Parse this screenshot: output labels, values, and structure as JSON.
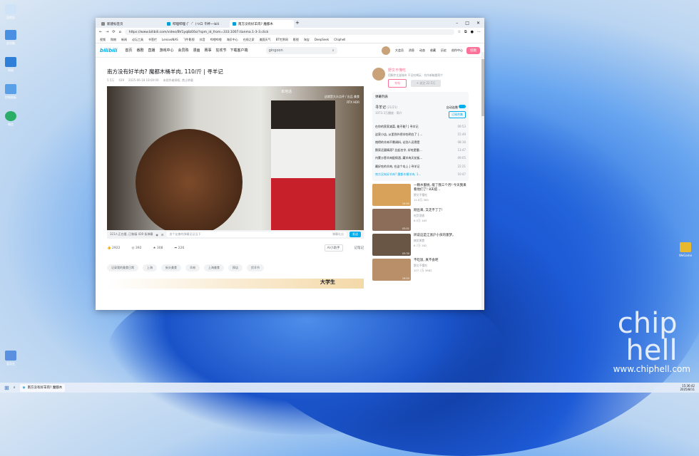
{
  "desktop": {
    "icons": [
      {
        "label": "回收站"
      },
      {
        "label": "此电脑"
      },
      {
        "label": "网络"
      },
      {
        "label": "控制面板"
      },
      {
        "label": "微信"
      }
    ],
    "right_icon": "WeGame",
    "bottom_icon": "爱奇艺"
  },
  "browser": {
    "tabs": [
      {
        "label": "新建标签页"
      },
      {
        "label": "哔哩哔哩 (゜-゜)つロ 干杯~-bili"
      },
      {
        "label": "南方没有好羊肉? 魔都木"
      }
    ],
    "url": "https://www.bilibili.com/video/BV1yq8zE6o/?spm_id_from=333.1007.tianma.1-3-3.click",
    "bookmarks": [
      "视频",
      "购物",
      "新闻",
      "论坛工具",
      "书签栏",
      "LenovoNAS",
      "飞牛影视",
      "抖音",
      "哔哩哔哩",
      "海贝中心",
      "在线之家",
      "美国天气",
      "BT世界网",
      "影视",
      "淘宝",
      "DeepSeek",
      "Chiphell"
    ]
  },
  "nav": {
    "logo": "bilibili",
    "items": [
      "首页",
      "番剧",
      "直播",
      "游戏中心",
      "会员购",
      "漫画",
      "赛事",
      "狂欢节"
    ],
    "download": "下载客户端",
    "search_placeholder": "gingoon",
    "right": [
      "大会员",
      "消息",
      "动态",
      "收藏",
      "历史",
      "创作中心"
    ],
    "upload": "投稿"
  },
  "video": {
    "title": "南方没有好羊肉? 魔都木桶羊肉, 110/斤 | 寻羊记",
    "views": "5.5万",
    "danmaku": "439",
    "date": "2025-06-18 18:00:00",
    "note": "未经作者授权, 禁止转载",
    "overlay_tl": "本地话",
    "overlay_tr": "这就是大众点评 / 出品 美食",
    "overlay_tr2": "RTX HDR",
    "online": "323人正在看, 已装填 439 条弹幕",
    "danmaku_placeholder": "发个友善的弹幕见证当下",
    "danmaku_etiquette": "弹幕礼仪",
    "send": "发送",
    "likes": "2922",
    "coins": "392",
    "favs": "308",
    "shares": "226",
    "ai": "AI小助手",
    "notes": "记笔记",
    "tags": [
      "记录我的美食日常",
      "上海",
      "街头美食",
      "羊肉",
      "上海美食",
      "探店",
      "伏羊节"
    ],
    "ad_text": "大学生"
  },
  "uploader": {
    "name": "野文不懂吃",
    "desc": "用脚步丈量城市 不见吃喝玩 · 合作邮箱看简介",
    "charge": "充电",
    "follow": "+ 关注 22.5万"
  },
  "playlist": {
    "heading": "弹幕列表",
    "name": "寻羊记",
    "count": "(21/21)",
    "views": "1073.3万播放 · 简介",
    "autoplay": "自动连播",
    "subscribe": "订阅合集",
    "items": [
      {
        "t": "在你的家家减菜, 能不能? | 寻羊记",
        "d": "09:53"
      },
      {
        "t": "这家小店, 从里到外把羊吃明白了 | ...",
        "d": "15:49"
      },
      {
        "t": "炮得的羊肉不需调料, 论别人还得是",
        "d": "08:16"
      },
      {
        "t": "鹅家还要精湛? 比起名字, 好吃更重...",
        "d": "13:47"
      },
      {
        "t": "内蒙沙葱羊肉配佩酒, 藏羊肉天花板...",
        "d": "09:05"
      },
      {
        "t": "最好吃的羊肉, 在这个岛上 | 寻羊记",
        "d": "22:21"
      },
      {
        "t": "南方没有好羊肉? 魔都木桶羊肉, 1...",
        "d": "10:47",
        "active": true
      }
    ]
  },
  "recs": [
    {
      "title": "一颗水蜜桃, 能了我三个月! 今天我来看他们了! 8天提...",
      "author": "野文不懂吃",
      "views": "11.6万",
      "dm": "369",
      "dur": "15:55"
    },
    {
      "title": "刚出来, 又走不了了!",
      "author": "吃货酒香",
      "views": "6.5万",
      "dm": "163",
      "dur": "03:01"
    },
    {
      "title": "听说这是江浙沪小孩的噩梦。",
      "author": "搞笑美食",
      "views": "6.7万",
      "dm": "162",
      "dur": "03:30"
    },
    {
      "title": "不吃饭, 真不会吧",
      "author": "野文不懂吃",
      "views": "107.7万",
      "dm": "3682",
      "dur": "19:53"
    }
  ],
  "taskbar": {
    "app": "南方没有好羊肉? 魔都木",
    "time": "15:36:42",
    "date": "2025/8/11"
  },
  "watermark": {
    "brand": "chip hell",
    "url": "www.chiphell.com"
  }
}
